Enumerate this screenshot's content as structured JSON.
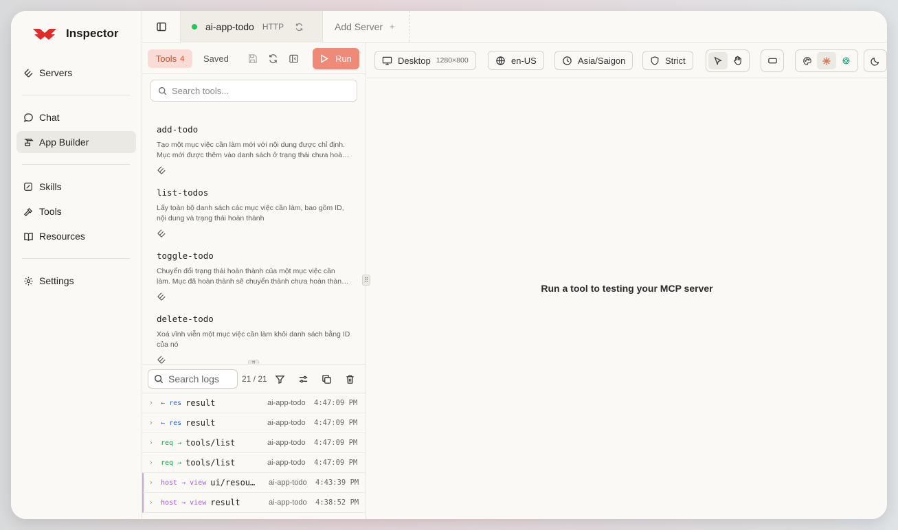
{
  "app": {
    "title": "Inspector"
  },
  "sidebar": {
    "items": [
      {
        "label": "Servers",
        "icon": "servers-icon"
      },
      {
        "label": "Chat",
        "icon": "chat-icon"
      },
      {
        "label": "App Builder",
        "icon": "app-builder-icon",
        "active": true
      },
      {
        "label": "Skills",
        "icon": "skills-icon"
      },
      {
        "label": "Tools",
        "icon": "hammer-icon"
      },
      {
        "label": "Resources",
        "icon": "book-icon"
      },
      {
        "label": "Settings",
        "icon": "gear-icon"
      }
    ]
  },
  "tabs": {
    "server": {
      "name": "ai-app-todo",
      "protocol": "HTTP",
      "status": "connected"
    },
    "add_server": "Add Server",
    "add_plus": "+"
  },
  "tools_panel": {
    "tools_label": "Tools",
    "tools_count": "4",
    "saved_label": "Saved",
    "run_label": "Run",
    "search_placeholder": "Search tools...",
    "tools": [
      {
        "name": "add-todo",
        "description": "Tạo một mục việc cần làm mới với nội dung được chỉ định. Mục mới được thêm vào danh sách ở trạng thái chưa hoàn thành."
      },
      {
        "name": "list-todos",
        "description": "Lấy toàn bộ danh sách các mục việc cần làm, bao gồm ID, nội dung và trạng thái hoàn thành"
      },
      {
        "name": "toggle-todo",
        "description": "Chuyển đổi trạng thái hoàn thành của một mục việc cần làm. Mục đã hoàn thành sẽ chuyển thành chưa hoàn thành và ngược lại."
      },
      {
        "name": "delete-todo",
        "description": "Xoá vĩnh viễn một mục việc cần làm khỏi danh sách bằng ID của nó"
      }
    ]
  },
  "logs": {
    "search_placeholder": "Search logs",
    "count": "21 / 21",
    "rows": [
      {
        "dir_from": "←",
        "dir_to": "res",
        "method": "result",
        "server": "ai-app-todo",
        "time": "4:47:09 PM",
        "kind": "res"
      },
      {
        "dir_from": "←",
        "dir_to": "res",
        "method": "result",
        "server": "ai-app-todo",
        "time": "4:47:09 PM",
        "kind": "res"
      },
      {
        "dir_from": "req",
        "dir_to": "→",
        "method": "tools/list",
        "server": "ai-app-todo",
        "time": "4:47:09 PM",
        "kind": "req"
      },
      {
        "dir_from": "req",
        "dir_to": "→",
        "method": "tools/list",
        "server": "ai-app-todo",
        "time": "4:47:09 PM",
        "kind": "req"
      },
      {
        "dir_from": "host → view",
        "dir_to": "",
        "method": "ui/resources/read",
        "server": "ai-app-todo",
        "time": "4:43:39 PM",
        "kind": "view"
      },
      {
        "dir_from": "host → view",
        "dir_to": "",
        "method": "result",
        "server": "ai-app-todo",
        "time": "4:38:52 PM",
        "kind": "view"
      },
      {
        "dir_from": "",
        "dir_to": "",
        "method": "",
        "server": "",
        "time": "",
        "kind": "cut"
      }
    ]
  },
  "preview": {
    "device_label": "Desktop",
    "device_size": "1280×800",
    "locale": "en-US",
    "timezone": "Asia/Saigon",
    "csp": "Strict",
    "empty_message": "Run a tool to testing your MCP server"
  },
  "colors": {
    "accent": "#f08a78",
    "accent_text": "#d9482c",
    "status_connected": "#22c55e",
    "res": "#2563eb",
    "req": "#16a34a",
    "view": "#a855f7"
  }
}
